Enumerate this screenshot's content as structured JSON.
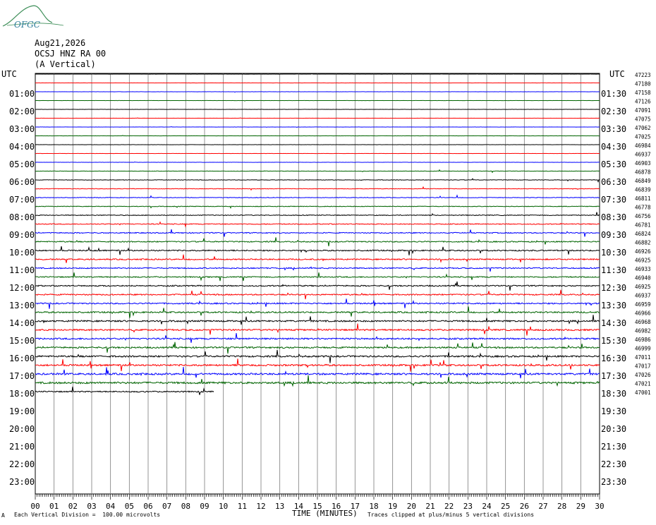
{
  "logo": {
    "text": "OFGC",
    "color": "#2e7d9a",
    "swoosh_color": "#3f8f5a"
  },
  "header": {
    "date": "Aug21,2026",
    "station": "OCSJ HNZ RA 00",
    "component": "(A Vertical)"
  },
  "footer": {
    "scale_note": "Each Vertical Division =  100.00 microvolts",
    "corner_mark": "A",
    "clip_note": "Traces clipped at plus/minus 5 vertical divisions"
  },
  "chart_data": {
    "type": "helicorder",
    "xlabel": "TIME (MINUTES)",
    "x_ticks": [
      "00",
      "01",
      "02",
      "03",
      "04",
      "05",
      "06",
      "07",
      "08",
      "09",
      "10",
      "11",
      "12",
      "13",
      "14",
      "15",
      "16",
      "17",
      "18",
      "19",
      "20",
      "21",
      "22",
      "23",
      "24",
      "25",
      "26",
      "27",
      "28",
      "29",
      "30"
    ],
    "xlim": [
      0,
      30
    ],
    "left_axis_title": "UTC",
    "right_axis_title": "UTC",
    "left_hour_labels": [
      "01:00",
      "02:00",
      "03:00",
      "04:00",
      "05:00",
      "06:00",
      "07:00",
      "08:00",
      "09:00",
      "10:00",
      "11:00",
      "12:00",
      "13:00",
      "14:00",
      "15:00",
      "16:00",
      "17:00",
      "18:00",
      "19:00",
      "20:00",
      "21:00",
      "22:00",
      "23:00"
    ],
    "right_hour_labels": [
      "01:30",
      "02:30",
      "03:30",
      "04:30",
      "05:30",
      "06:30",
      "07:30",
      "08:30",
      "09:30",
      "10:30",
      "11:30",
      "12:30",
      "13:30",
      "14:30",
      "15:30",
      "16:30",
      "17:30",
      "18:30",
      "19:30",
      "20:30",
      "21:30",
      "22:30",
      "23:30"
    ],
    "trace_colors": [
      "#000000",
      "#ff0000",
      "#0000ff",
      "#006400"
    ],
    "trace_count": 37,
    "trace_offsets": [
      "47223",
      "47180",
      "47158",
      "47126",
      "47091",
      "47075",
      "47062",
      "47025",
      "46984",
      "46937",
      "46903",
      "46878",
      "46849",
      "46839",
      "46811",
      "46778",
      "46756",
      "46781",
      "46824",
      "46882",
      "46926",
      "46925",
      "46933",
      "46940",
      "46925",
      "46937",
      "46959",
      "46966",
      "46968",
      "46982",
      "46986",
      "46999",
      "47011",
      "47017",
      "47026",
      "47021",
      "47001"
    ],
    "activity_level": [
      0.05,
      0.05,
      0.06,
      0.05,
      0.07,
      0.05,
      0.05,
      0.06,
      0.07,
      0.07,
      0.1,
      0.15,
      0.2,
      0.22,
      0.25,
      0.3,
      0.35,
      0.4,
      0.45,
      0.5,
      0.55,
      0.55,
      0.5,
      0.5,
      0.55,
      0.55,
      0.6,
      0.65,
      0.7,
      0.7,
      0.7,
      0.7,
      0.75,
      0.75,
      0.8,
      0.85,
      0.55
    ]
  }
}
